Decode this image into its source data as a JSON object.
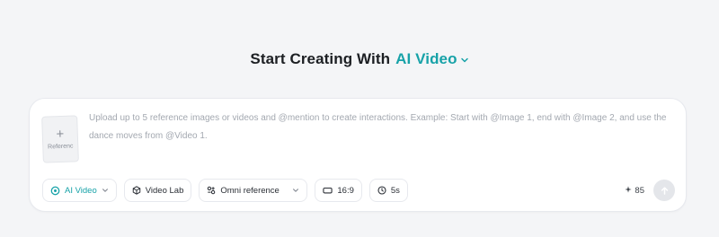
{
  "heading": {
    "lead": "Start Creating With",
    "mode": "AI Video"
  },
  "reference": {
    "plus": "+",
    "label": "Referenc"
  },
  "prompt": {
    "placeholder": "Upload up to 5 reference images or videos and @mention to create interactions. Example: Start with @Image 1, end with @Image 2, and use the dance moves from @Video 1."
  },
  "toolbar": {
    "ai_video": "AI Video",
    "video_lab": "Video Lab",
    "omni_reference": "Omni reference",
    "aspect_ratio": "16:9",
    "duration": "5s",
    "credits": "85"
  },
  "colors": {
    "accent": "#17a2a8",
    "background": "#f4f5f7",
    "card": "#ffffff",
    "send_disabled": "#e4e6ea"
  },
  "icons": {
    "mode_dropdown": "chevron-down-icon",
    "ai_video": "ai-video-icon",
    "video_lab": "cube-icon",
    "omni_reference": "omni-icon",
    "aspect_ratio": "aspect-ratio-icon",
    "duration": "clock-icon",
    "credits": "sparkle-icon",
    "send": "arrow-up-icon"
  }
}
